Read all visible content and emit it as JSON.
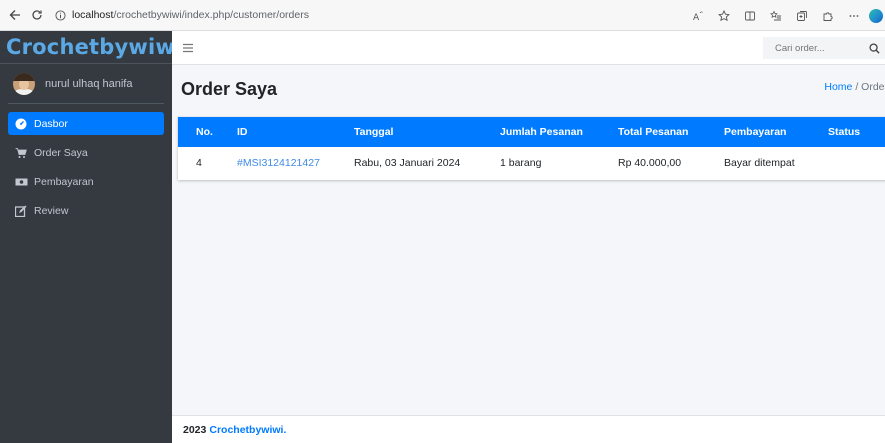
{
  "browser": {
    "url_host": "localhost",
    "url_path": "/crochetbywiwi/index.php/customer/orders"
  },
  "sidebar": {
    "brand": "Crochetbywiwi",
    "user_name": "nurul ulhaq hanifa",
    "items": [
      {
        "label": "Dasbor",
        "icon": "dashboard-icon",
        "active": true
      },
      {
        "label": "Order Saya",
        "icon": "cart-icon",
        "active": false
      },
      {
        "label": "Pembayaran",
        "icon": "money-icon",
        "active": false
      },
      {
        "label": "Review",
        "icon": "edit-icon",
        "active": false
      }
    ]
  },
  "topbar": {
    "search_placeholder": "Cari order..."
  },
  "header": {
    "title": "Order Saya",
    "breadcrumb_home": "Home",
    "breadcrumb_sep": "/",
    "breadcrumb_current": "Order"
  },
  "table": {
    "columns": [
      "No.",
      "ID",
      "Tanggal",
      "Jumlah Pesanan",
      "Total Pesanan",
      "Pembayaran",
      "Status"
    ],
    "rows": [
      {
        "no": "4",
        "id": "#MSI3124121427",
        "tanggal": "Rabu, 03 Januari 2024",
        "jumlah": "1 barang",
        "total": "Rp 40.000,00",
        "pembayaran": "Bayar ditempat",
        "status": ""
      }
    ]
  },
  "footer": {
    "year": "2023",
    "brand": "Crochetbywiwi."
  },
  "colors": {
    "primary": "#007bff",
    "sidebar_bg": "#343a40",
    "brand_text": "#5aa9e6"
  }
}
